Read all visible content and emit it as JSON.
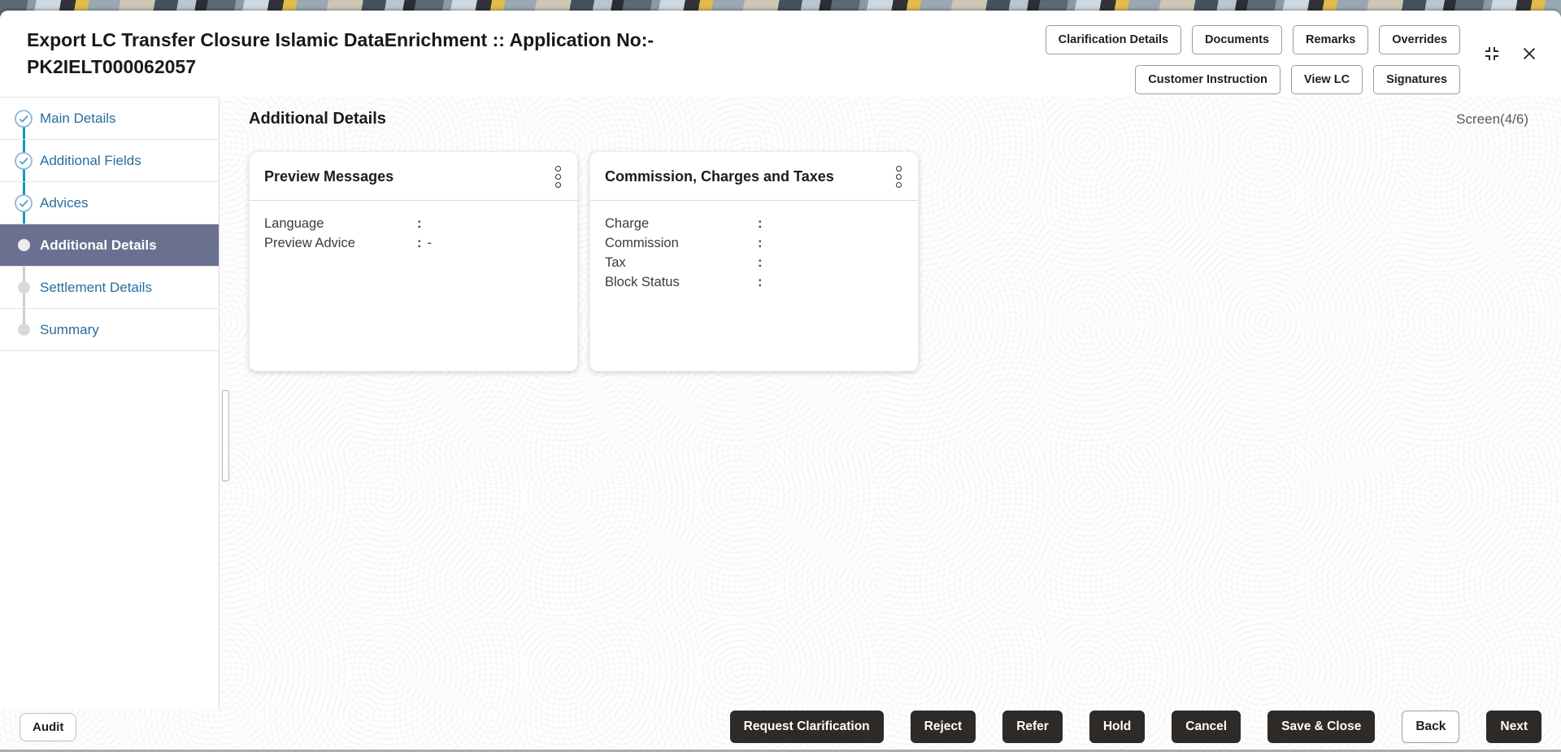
{
  "header": {
    "title": "Export LC Transfer Closure Islamic DataEnrichment :: Application No:- PK2IELT000062057",
    "actions_row1": [
      "Clarification Details",
      "Documents",
      "Remarks",
      "Overrides"
    ],
    "actions_row2": [
      "Customer Instruction",
      "View LC",
      "Signatures"
    ]
  },
  "sidebar": {
    "items": [
      {
        "label": "Main Details",
        "state": "completed"
      },
      {
        "label": "Additional Fields",
        "state": "completed"
      },
      {
        "label": "Advices",
        "state": "completed"
      },
      {
        "label": "Additional Details",
        "state": "current"
      },
      {
        "label": "Settlement Details",
        "state": "upcoming"
      },
      {
        "label": "Summary",
        "state": "upcoming"
      }
    ]
  },
  "content": {
    "heading": "Additional Details",
    "screen_indicator": "Screen(4/6)",
    "cards": [
      {
        "title": "Preview Messages",
        "fields": [
          {
            "label": "Language",
            "sep": ":",
            "value": ""
          },
          {
            "label": "Preview Advice",
            "sep": ":",
            "value": "-"
          }
        ]
      },
      {
        "title": "Commission, Charges and Taxes",
        "fields": [
          {
            "label": "Charge",
            "sep": ":",
            "value": ""
          },
          {
            "label": "Commission",
            "sep": ":",
            "value": ""
          },
          {
            "label": "Tax",
            "sep": ":",
            "value": ""
          },
          {
            "label": "Block Status",
            "sep": ":",
            "value": ""
          }
        ]
      }
    ]
  },
  "footer": {
    "audit_label": "Audit",
    "actions": [
      {
        "label": "Request Clarification",
        "variant": "dark"
      },
      {
        "label": "Reject",
        "variant": "dark"
      },
      {
        "label": "Refer",
        "variant": "dark"
      },
      {
        "label": "Hold",
        "variant": "dark"
      },
      {
        "label": "Cancel",
        "variant": "dark"
      },
      {
        "label": "Save & Close",
        "variant": "dark"
      },
      {
        "label": "Back",
        "variant": "light"
      },
      {
        "label": "Next",
        "variant": "dark"
      }
    ]
  },
  "colors": {
    "accent_teal": "#1898ba",
    "link_blue": "#2a6d9c",
    "selected_nav_bg": "#6a7190",
    "dark_button_bg": "#2e2a27"
  }
}
